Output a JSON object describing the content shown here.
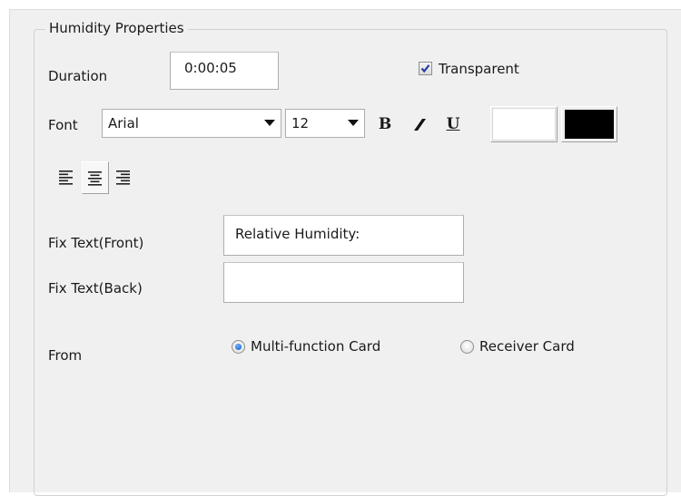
{
  "group": {
    "title": "Humidity Properties"
  },
  "duration": {
    "label": "Duration",
    "value": "0:00:05"
  },
  "transparent": {
    "label": "Transparent",
    "checked": true
  },
  "font": {
    "label": "Font",
    "family": "Arial",
    "size": "12",
    "bold_glyph": "B",
    "italic_glyph": "I",
    "underline_glyph": "U",
    "background_color": "#ffffff",
    "foreground_color": "#000000"
  },
  "alignment": {
    "options": [
      "align-left",
      "align-center",
      "align-right"
    ],
    "selected": "align-center"
  },
  "fix_text_front": {
    "label": "Fix Text(Front)",
    "value": "Relative Humidity:"
  },
  "fix_text_back": {
    "label": "Fix Text(Back)",
    "value": ""
  },
  "source": {
    "label": "From",
    "options": [
      "Multi-function Card",
      "Receiver Card"
    ],
    "selected": "Multi-function Card"
  }
}
